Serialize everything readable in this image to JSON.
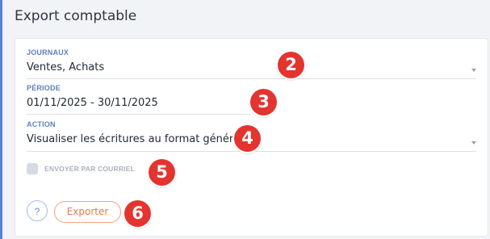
{
  "header": {
    "title": "Export comptable"
  },
  "form": {
    "journaux": {
      "label": "JOURNAUX",
      "value": "Ventes, Achats"
    },
    "periode": {
      "label": "PÉRIODE",
      "value": "01/11/2025 - 30/11/2025"
    },
    "action": {
      "label": "ACTION",
      "value": "Visualiser les écritures au format générique"
    },
    "courriel": {
      "label": "ENVOYER PAR COURRIEL",
      "checked": false,
      "disabled": true
    }
  },
  "buttons": {
    "help_label": "?",
    "export_label": "Exporter"
  },
  "annotations": [
    "2",
    "3",
    "4",
    "5",
    "6"
  ],
  "icons": {
    "dropdown": "chevron-down-icon"
  },
  "colors": {
    "accent_blue": "#5f7fc0",
    "export_orange": "#e5794c",
    "badge_red": "#e3342f"
  }
}
